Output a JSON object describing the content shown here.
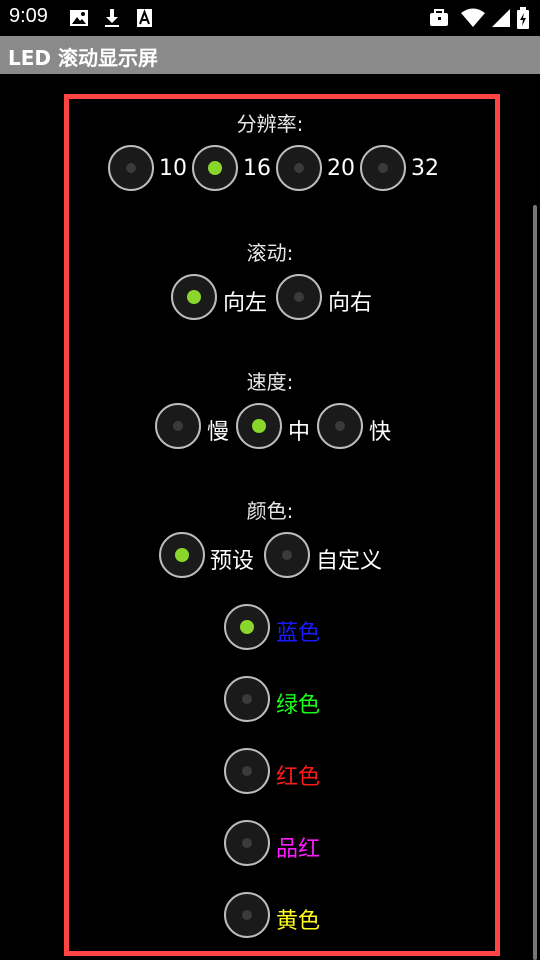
{
  "status": {
    "time": "9:09"
  },
  "app": {
    "title": "LED 滚动显示屏"
  },
  "resolution": {
    "label": "分辨率:",
    "options": [
      "10",
      "16",
      "20",
      "32"
    ],
    "selected": "16"
  },
  "scroll": {
    "label": "滚动:",
    "options": [
      "向左",
      "向右"
    ],
    "selected": "向左"
  },
  "speed": {
    "label": "速度:",
    "options": [
      "慢",
      "中",
      "快"
    ],
    "selected": "中"
  },
  "color": {
    "label": "颜色:",
    "options": [
      "预设",
      "自定义"
    ],
    "selected": "预设"
  },
  "presets": [
    {
      "label": "蓝色",
      "color": "#1a1aff",
      "selected": true
    },
    {
      "label": "绿色",
      "color": "#1aff1a",
      "selected": false
    },
    {
      "label": "红色",
      "color": "#ff1a1a",
      "selected": false
    },
    {
      "label": "品红",
      "color": "#ff1aff",
      "selected": false
    },
    {
      "label": "黄色",
      "color": "#ffff1a",
      "selected": false
    }
  ],
  "icons": {
    "status_left": [
      "image-icon",
      "download-icon",
      "font-icon"
    ],
    "status_right": [
      "briefcase-icon",
      "wifi-icon",
      "signal-icon",
      "battery-icon"
    ]
  },
  "accent": "#8bd62c",
  "panel_border": "#ff4444"
}
